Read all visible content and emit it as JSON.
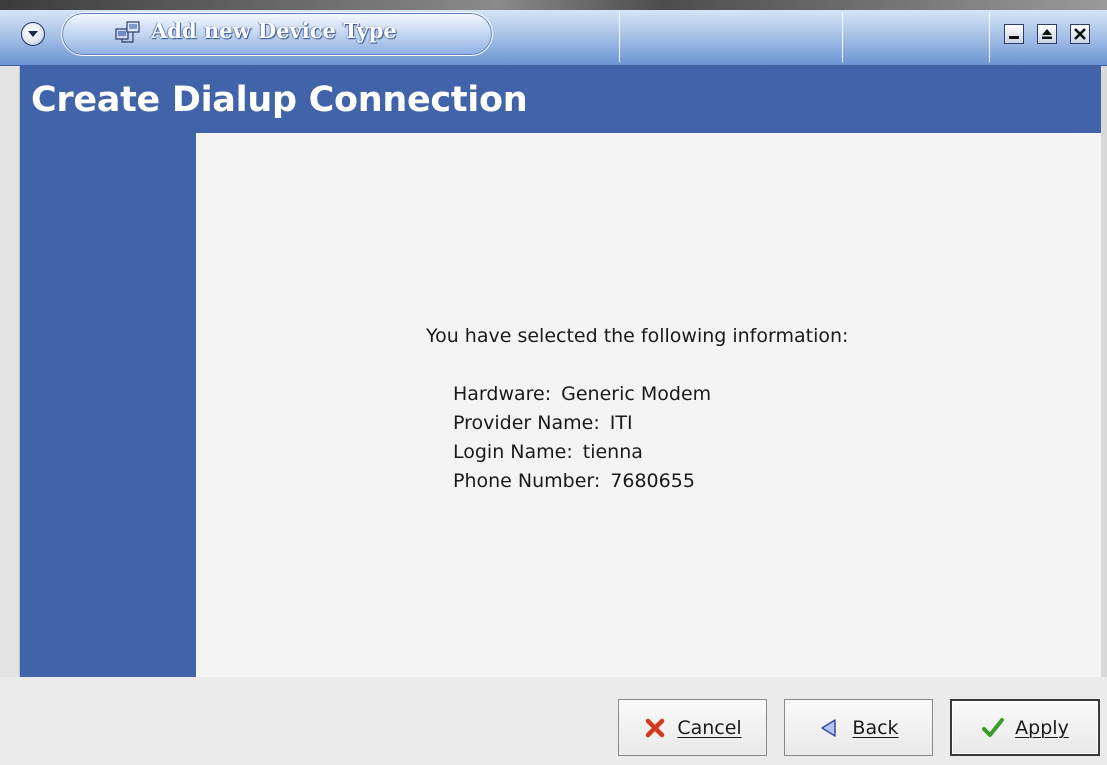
{
  "window": {
    "title": "Add new Device Type",
    "controls": {
      "minimize": "minimize-icon",
      "maximize": "maximize-icon",
      "close": "close-icon"
    }
  },
  "header": {
    "title": "Create Dialup Connection"
  },
  "summary": {
    "intro": "You have selected the following information:",
    "fields": [
      {
        "label": "Hardware:",
        "value": "Generic Modem"
      },
      {
        "label": "Provider Name:",
        "value": "ITI"
      },
      {
        "label": "Login Name:",
        "value": "tienna"
      },
      {
        "label": "Phone Number:",
        "value": "7680655"
      }
    ]
  },
  "buttons": {
    "cancel": {
      "label": "Cancel",
      "icon": "x-icon",
      "mnemonic": "C"
    },
    "back": {
      "label": "Back",
      "icon": "left-arrow-icon",
      "mnemonic": "B"
    },
    "apply": {
      "label": "Apply",
      "icon": "checkmark-icon",
      "mnemonic": "A"
    }
  },
  "colors": {
    "accent": "#4163aa",
    "content_background": "#f4f4f4",
    "title_bar": "#a7c2e8",
    "cancel_icon": "#d23a1e",
    "back_icon": "#6e7fd0",
    "apply_icon": "#3c9a2a"
  }
}
